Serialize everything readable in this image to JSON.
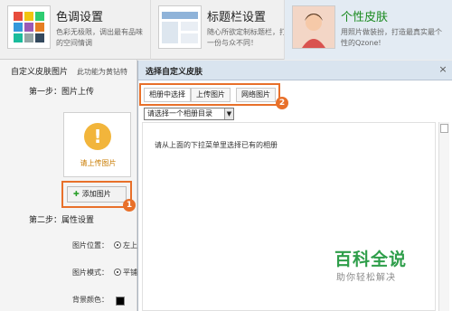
{
  "top_tabs": [
    {
      "title": "色调设置",
      "desc": "色彩无极限，调出最有品味的空间情调"
    },
    {
      "title": "标题栏设置",
      "desc": "随心所欲定制标题栏，打造一份与众不同！"
    },
    {
      "title": "个性皮肤",
      "desc": "用照片做装扮，打造最真实最个性的Qzone!"
    }
  ],
  "panel": {
    "heading": "自定义皮肤图片",
    "heading_sub": "此功能为黄钻特",
    "step1": "第一步：图片上传",
    "upload_label": "请上传图片",
    "add_button": "添加图片",
    "step2": "第二步：属性设置",
    "position_label": "图片位置：",
    "position_value": "左上",
    "mode_label": "图片模式：",
    "mode_value": "平铺",
    "bg_color_label": "背景颜色："
  },
  "dialog": {
    "title": "选择自定义皮肤",
    "close": "×",
    "tabs": [
      "相册中选择",
      "上传图片",
      "网络图片"
    ],
    "album_select": "请选择一个相册目录",
    "hint": "请从上面的下拉菜单里选择已有的相册"
  },
  "annotations": {
    "badge1": "1",
    "badge2": "2"
  },
  "watermark": {
    "main": "百科全说",
    "sub": "助你轻松解决"
  },
  "colors": {
    "highlight": "#e8702a",
    "skin_title": "#198a1e",
    "watermark": "#2e9e4a"
  }
}
